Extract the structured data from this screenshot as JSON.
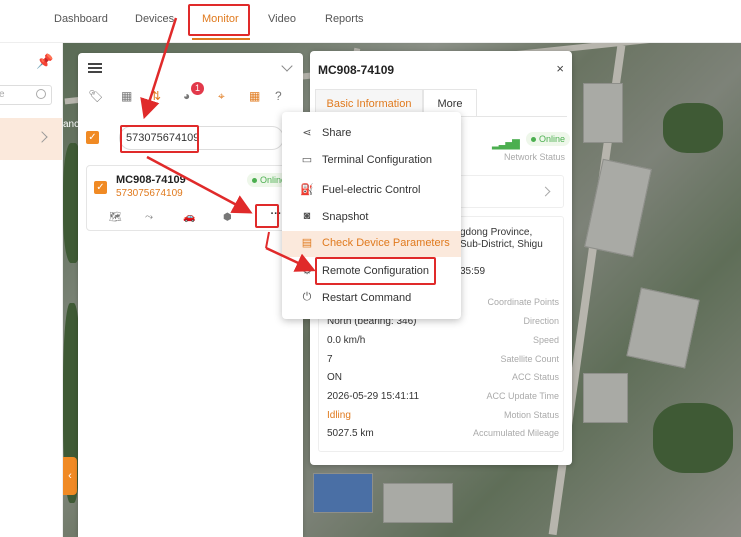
{
  "nav": {
    "items": [
      "Dashboard",
      "Devices",
      "Monitor",
      "Video",
      "Reports"
    ],
    "active": "Monitor"
  },
  "left": {
    "search_placeholder": "e"
  },
  "map": {
    "label_fragment": "anc"
  },
  "list": {
    "search_value": "573075674109",
    "badge_count": "1",
    "device": {
      "name": "MC908-74109",
      "imei": "573075674109",
      "status": "Online",
      "more_label": "···"
    }
  },
  "detail": {
    "title": "MC908-74109",
    "close": "×",
    "tabs": [
      "Basic Information",
      "More"
    ],
    "status": "Online",
    "network_label": "Network Status",
    "address_line1": "gdong Province,",
    "address_line2": "Sub-District, Shigu",
    "time_fragment": "35:59",
    "rows": [
      {
        "value": "",
        "label": "Coordinate Points"
      },
      {
        "value": "North (bearing: 346)",
        "label": "Direction"
      },
      {
        "value": "0.0 km/h",
        "label": "Speed"
      },
      {
        "value": "7",
        "label": "Satellite Count"
      },
      {
        "value": "ON",
        "label": "ACC Status"
      },
      {
        "value": "2026-05-29 15:41:11",
        "label": "ACC Update Time"
      },
      {
        "value": "Idling",
        "label": "Motion Status"
      },
      {
        "value": "5027.5 km",
        "label": "Accumulated Mileage"
      }
    ]
  },
  "dropdown": {
    "items": [
      {
        "label": "Share",
        "icon": "share-icon"
      },
      {
        "label": "Terminal Configuration",
        "icon": "terminal-icon"
      },
      {
        "label": "Fuel-electric Control",
        "icon": "fuel-icon"
      },
      {
        "label": "Snapshot",
        "icon": "camera-icon"
      },
      {
        "label": "Check Device Parameters",
        "icon": "document-icon"
      },
      {
        "label": "Remote Configuration",
        "icon": "remote-config-icon"
      },
      {
        "label": "Restart Command",
        "icon": "power-icon"
      }
    ],
    "highlighted": "Check Device Parameters"
  },
  "colors": {
    "accent": "#e07a1e",
    "annotation": "#e02a2a",
    "online": "#4caf50"
  }
}
